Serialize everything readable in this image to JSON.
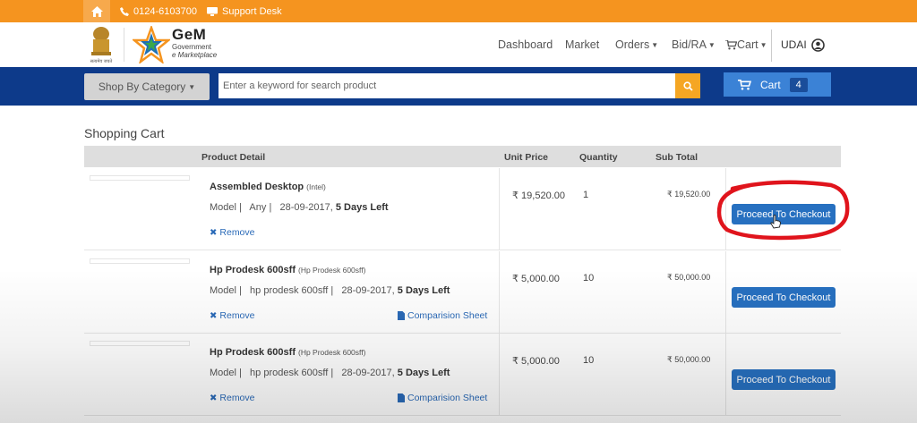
{
  "topbar": {
    "phone": "0124-6103700",
    "support": "Support Desk"
  },
  "header": {
    "brand_title": "GeM",
    "brand_sub1": "Government",
    "brand_sub2": "e Marketplace",
    "emblem_caption": "सत्यमेव जयते",
    "nav": [
      {
        "label": "Dashboard"
      },
      {
        "label": "Market"
      },
      {
        "label": "Orders"
      },
      {
        "label": "Bid/RA"
      },
      {
        "label": "Cart"
      }
    ],
    "user": "UDAI"
  },
  "search": {
    "category_label": "Shop By Category",
    "placeholder": "Enter a keyword for search product",
    "cart_label": "Cart",
    "cart_count": "4"
  },
  "cart": {
    "title": "Shopping Cart",
    "columns": {
      "product": "Product Detail",
      "unit_price": "Unit Price",
      "quantity": "Quantity",
      "sub_total": "Sub Total"
    },
    "checkout_label": "Proceed To Checkout",
    "remove_label": "Remove",
    "compare_label": "Comparision Sheet",
    "items": [
      {
        "name": "Assembled Desktop",
        "brand": "(Intel)",
        "model": "Model |   Any |   28-09-2017, ",
        "days": "5 Days Left",
        "unit_price": "₹ 19,520.00",
        "quantity": "1",
        "sub_total": "₹ 19,520.00"
      },
      {
        "name": "Hp Prodesk 600sff",
        "brand": "(Hp Prodesk 600sff)",
        "model": "Model |   hp prodesk 600sff |   28-09-2017, ",
        "days": "5 Days Left",
        "unit_price": "₹ 5,000.00",
        "quantity": "10",
        "sub_total": "₹ 50,000.00"
      },
      {
        "name": "Hp Prodesk 600sff",
        "brand": "(Hp Prodesk 600sff)",
        "model": "Model |   hp prodesk 600sff |   28-09-2017, ",
        "days": "5 Days Left",
        "unit_price": "₹ 5,000.00",
        "quantity": "10",
        "sub_total": "₹ 50,000.00"
      }
    ]
  },
  "colors": {
    "topbar": "#f5941f",
    "band": "#0d3a8a",
    "accent_blue": "#2770c0",
    "search_button": "#f5a623",
    "annotation_red": "#e0141c"
  }
}
